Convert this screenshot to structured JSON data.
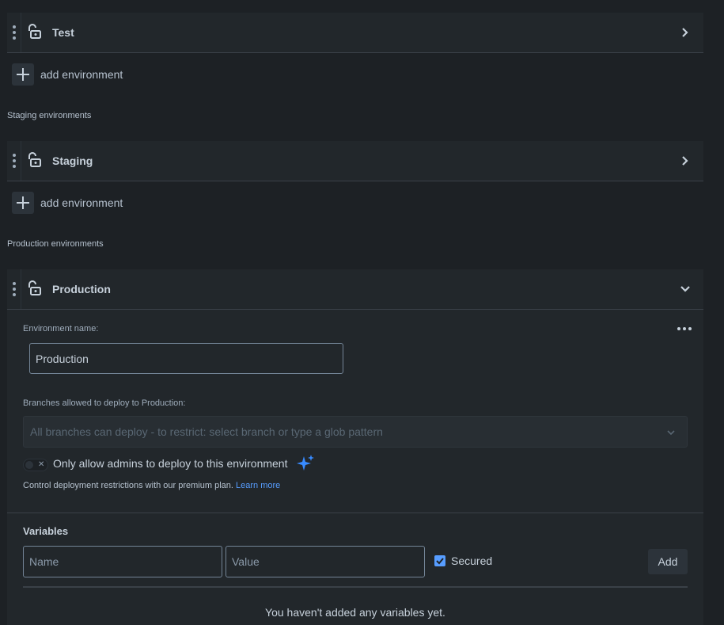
{
  "environments": {
    "test": {
      "name": "Test",
      "expanded": false
    },
    "staging_section_label": "Staging environments",
    "staging": {
      "name": "Staging",
      "expanded": false
    },
    "production_section_label": "Production environments",
    "production": {
      "name": "Production",
      "expanded": true
    }
  },
  "add_environment_label": "add environment",
  "production_panel": {
    "env_name_label": "Environment name:",
    "env_name_value": "Production",
    "branches_label": "Branches allowed to deploy to Production:",
    "branches_placeholder": "All branches can deploy - to restrict: select branch or type a glob pattern",
    "admin_toggle": {
      "label": "Only allow admins to deploy to this environment",
      "on": false
    },
    "help_text": "Control deployment restrictions with our premium plan.",
    "learn_more": "Learn more"
  },
  "variables": {
    "title": "Variables",
    "name_placeholder": "Name",
    "value_placeholder": "Value",
    "secured_label": "Secured",
    "secured_checked": true,
    "add_button": "Add",
    "empty_message": "You haven't added any variables yet."
  },
  "colors": {
    "background": "#1d2125",
    "row": "#22272b",
    "accent": "#579dff",
    "sparkle": "#388bff"
  }
}
